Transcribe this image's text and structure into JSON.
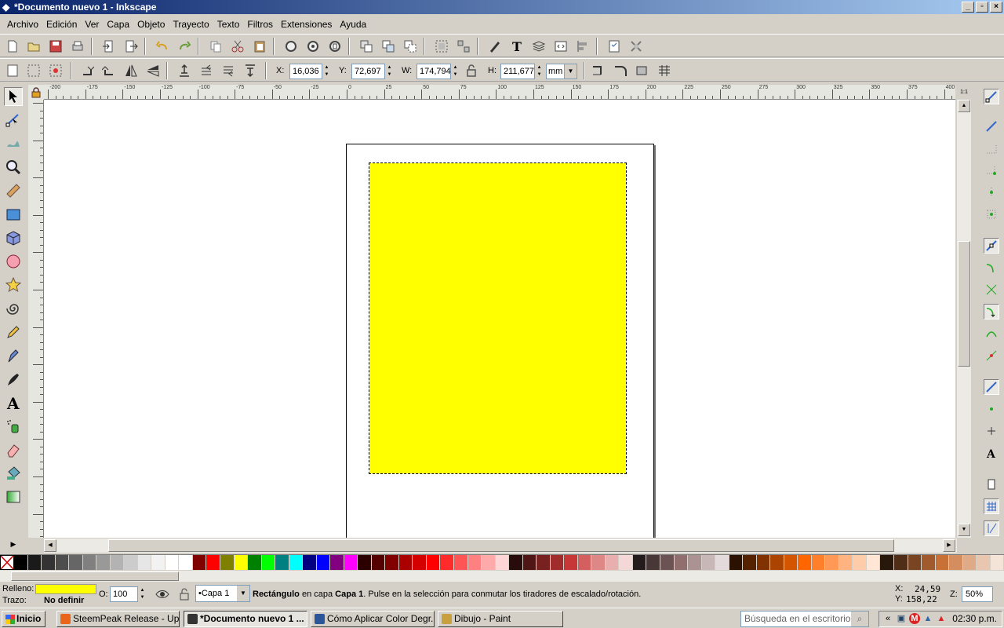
{
  "window": {
    "title": "*Documento nuevo 1 - Inkscape",
    "min": "_",
    "max": "▫",
    "close": "×"
  },
  "menu": [
    "Archivo",
    "Edición",
    "Ver",
    "Capa",
    "Objeto",
    "Trayecto",
    "Texto",
    "Filtros",
    "Extensiones",
    "Ayuda"
  ],
  "toolbar": {
    "x_label": "X:",
    "x_value": "16,036",
    "y_label": "Y:",
    "y_value": "72,697",
    "w_label": "W:",
    "w_value": "174,794",
    "h_label": "H:",
    "h_value": "211,677",
    "unit": "mm"
  },
  "ruler": {
    "top_labels": [
      "-200",
      "-175",
      "-150",
      "-125",
      "-100",
      "-75",
      "-50",
      "-25",
      "0",
      "25",
      "50",
      "75",
      "100",
      "125",
      "150",
      "175",
      "200",
      "225",
      "250",
      "275",
      "300",
      "325",
      "350",
      "375",
      "400"
    ],
    "corner": "1:1"
  },
  "status": {
    "fill_label": "Relleno:",
    "fill_color": "#ffff00",
    "stroke_label": "Trazo:",
    "stroke_value": "No definir",
    "opacity_label": "O:",
    "opacity_value": "100",
    "layer": "•Capa 1",
    "msg_bold": "Rectángulo",
    "msg_mid": " en capa ",
    "msg_layer": "Capa 1",
    "msg_rest": ". Pulse en la selección para conmutar los tiradores de escalado/rotación.",
    "x_label": "X:",
    "x_value": "24,59",
    "y_label": "Y:",
    "y_value": "158,22",
    "zoom_label": "Z:",
    "zoom_value": "50%"
  },
  "taskbar": {
    "start": "Inicio",
    "tasks": [
      {
        "label": "SteemPeak Release - Up...",
        "color": "#e8651a"
      },
      {
        "label": "*Documento nuevo 1 ...",
        "color": "#333333"
      },
      {
        "label": "Cómo Aplicar Color Degr...",
        "color": "#2b579a"
      },
      {
        "label": "Dibujo - Paint",
        "color": "#c8a040"
      }
    ],
    "search_placeholder": "Búsqueda en el escritorio",
    "tray_arrows": "«",
    "clock": "02:30 p.m."
  },
  "palette": [
    "#000000",
    "#1a1a1a",
    "#333333",
    "#4d4d4d",
    "#666666",
    "#808080",
    "#999999",
    "#b3b3b3",
    "#cccccc",
    "#e6e6e6",
    "#f2f2f2",
    "#ffffff",
    "#ffffff",
    "#800000",
    "#ff0000",
    "#808000",
    "#ffff00",
    "#008000",
    "#00ff00",
    "#008080",
    "#00ffff",
    "#000080",
    "#0000ff",
    "#800080",
    "#ff00ff",
    "#2b0000",
    "#550000",
    "#800000",
    "#aa0000",
    "#d40000",
    "#ff0000",
    "#ff2a2a",
    "#ff5555",
    "#ff8080",
    "#ffaaaa",
    "#ffd5d5",
    "#280b0b",
    "#501616",
    "#782121",
    "#a02c2c",
    "#c83737",
    "#d35f5f",
    "#de8787",
    "#e9afaf",
    "#f4d7d7",
    "#241c1c",
    "#483737",
    "#6c5353",
    "#916f6f",
    "#ac9393",
    "#c8b7b7",
    "#e3dbdb",
    "#2b1100",
    "#552200",
    "#803300",
    "#aa4400",
    "#d45500",
    "#ff6600",
    "#ff7f2a",
    "#ff9955",
    "#ffb380",
    "#ffccaa",
    "#ffe6d5",
    "#28170b",
    "#502d16",
    "#784421",
    "#a05a2c",
    "#c87137",
    "#d38d5f",
    "#deaa87",
    "#e9c6af",
    "#f4e3d7"
  ]
}
